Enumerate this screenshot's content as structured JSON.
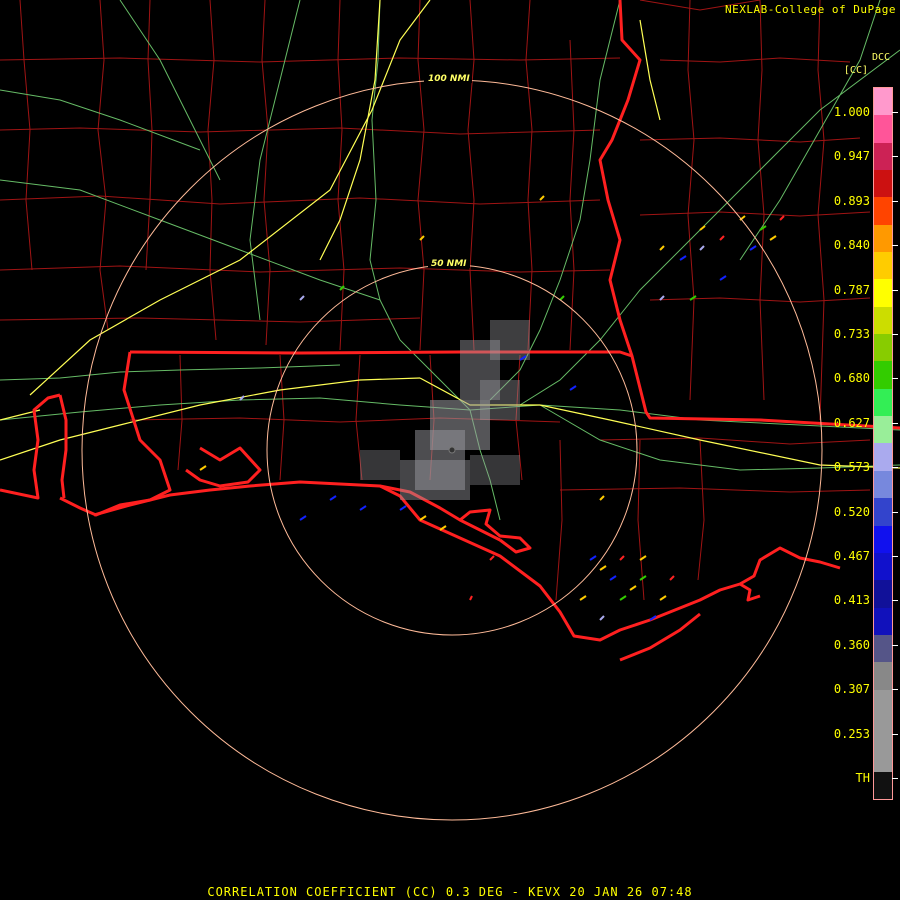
{
  "header": {
    "credit": "NEXLAB-College of DuPage",
    "product_code": "DCC",
    "units": "[CC]"
  },
  "range_rings": {
    "outer_label": "100 NMI",
    "inner_label": "50 NMI"
  },
  "colorbar": {
    "labels": [
      "1.000",
      "0.947",
      "0.893",
      "0.840",
      "0.787",
      "0.733",
      "0.680",
      "0.627",
      "0.573",
      "0.520",
      "0.467",
      "0.413",
      "0.360",
      "0.307",
      "0.253",
      "TH"
    ],
    "colors": [
      "#ff99cc",
      "#ff5599",
      "#cc2255",
      "#cc1111",
      "#ff4400",
      "#ff9900",
      "#ffcc00",
      "#ffff00",
      "#ccdd00",
      "#88cc00",
      "#33cc00",
      "#33ee55",
      "#99ee99",
      "#aaaaee",
      "#7788dd",
      "#3344cc",
      "#1111ee",
      "#1111cc",
      "#111199",
      "#1111bb",
      "#555588",
      "#888888",
      "#999999",
      "#999999",
      "#999999",
      "#111111"
    ]
  },
  "footer": {
    "title": "CORRELATION COEFFICIENT (CC) 0.3 DEG - KEVX 20 JAN 26 07:48"
  },
  "colors": {
    "state_border": "#ff2222",
    "county_line": "#aa1111",
    "highway": "#77cc77",
    "interstate": "#ffff55",
    "range_ring": "#ffbb99",
    "background": "#000000"
  }
}
